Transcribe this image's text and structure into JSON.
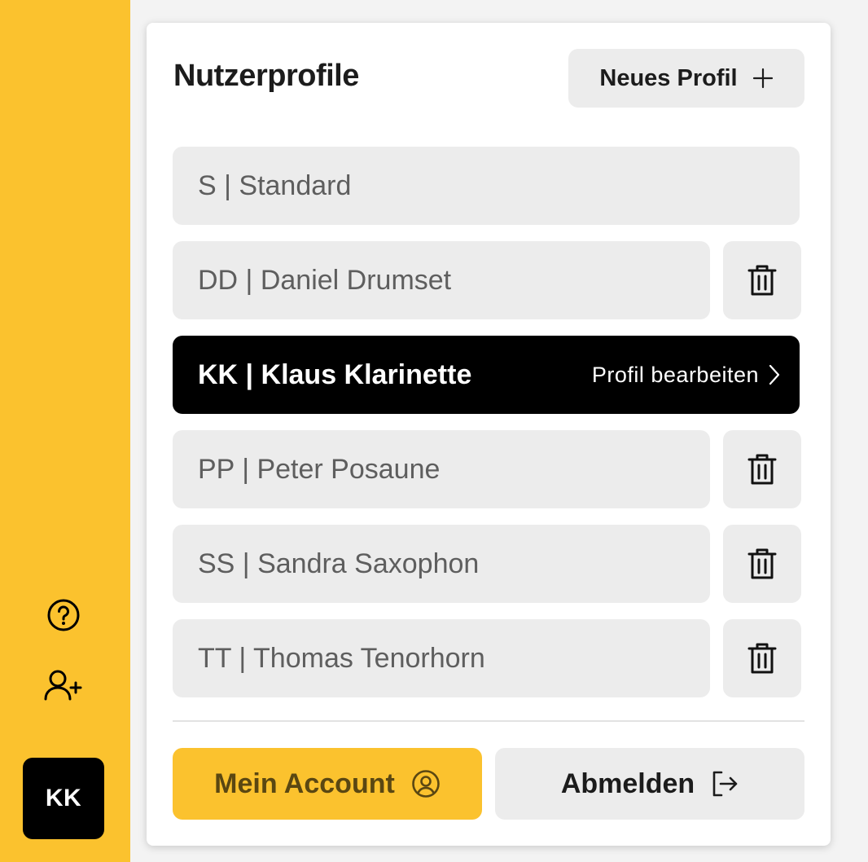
{
  "sidebar": {
    "help_icon": "question-circle-icon",
    "add_user_icon": "user-plus-icon",
    "avatar_initials": "KK",
    "accent_color": "#fbc22e"
  },
  "panel": {
    "title": "Nutzerprofile",
    "new_profile_label": "Neues Profil",
    "profiles": [
      {
        "label": "S | Standard",
        "deletable": false,
        "active": false
      },
      {
        "label": "DD | Daniel Drumset",
        "deletable": true,
        "active": false
      },
      {
        "label": "KK | Klaus Klarinette",
        "deletable": false,
        "active": true
      },
      {
        "label": "PP | Peter Posaune",
        "deletable": true,
        "active": false
      },
      {
        "label": "SS | Sandra Saxophon",
        "deletable": true,
        "active": false
      },
      {
        "label": "TT | Thomas Tenorhorn",
        "deletable": true,
        "active": false
      }
    ],
    "edit_profile_label": "Profil bearbeiten",
    "account_label": "Mein Account",
    "logout_label": "Abmelden"
  }
}
